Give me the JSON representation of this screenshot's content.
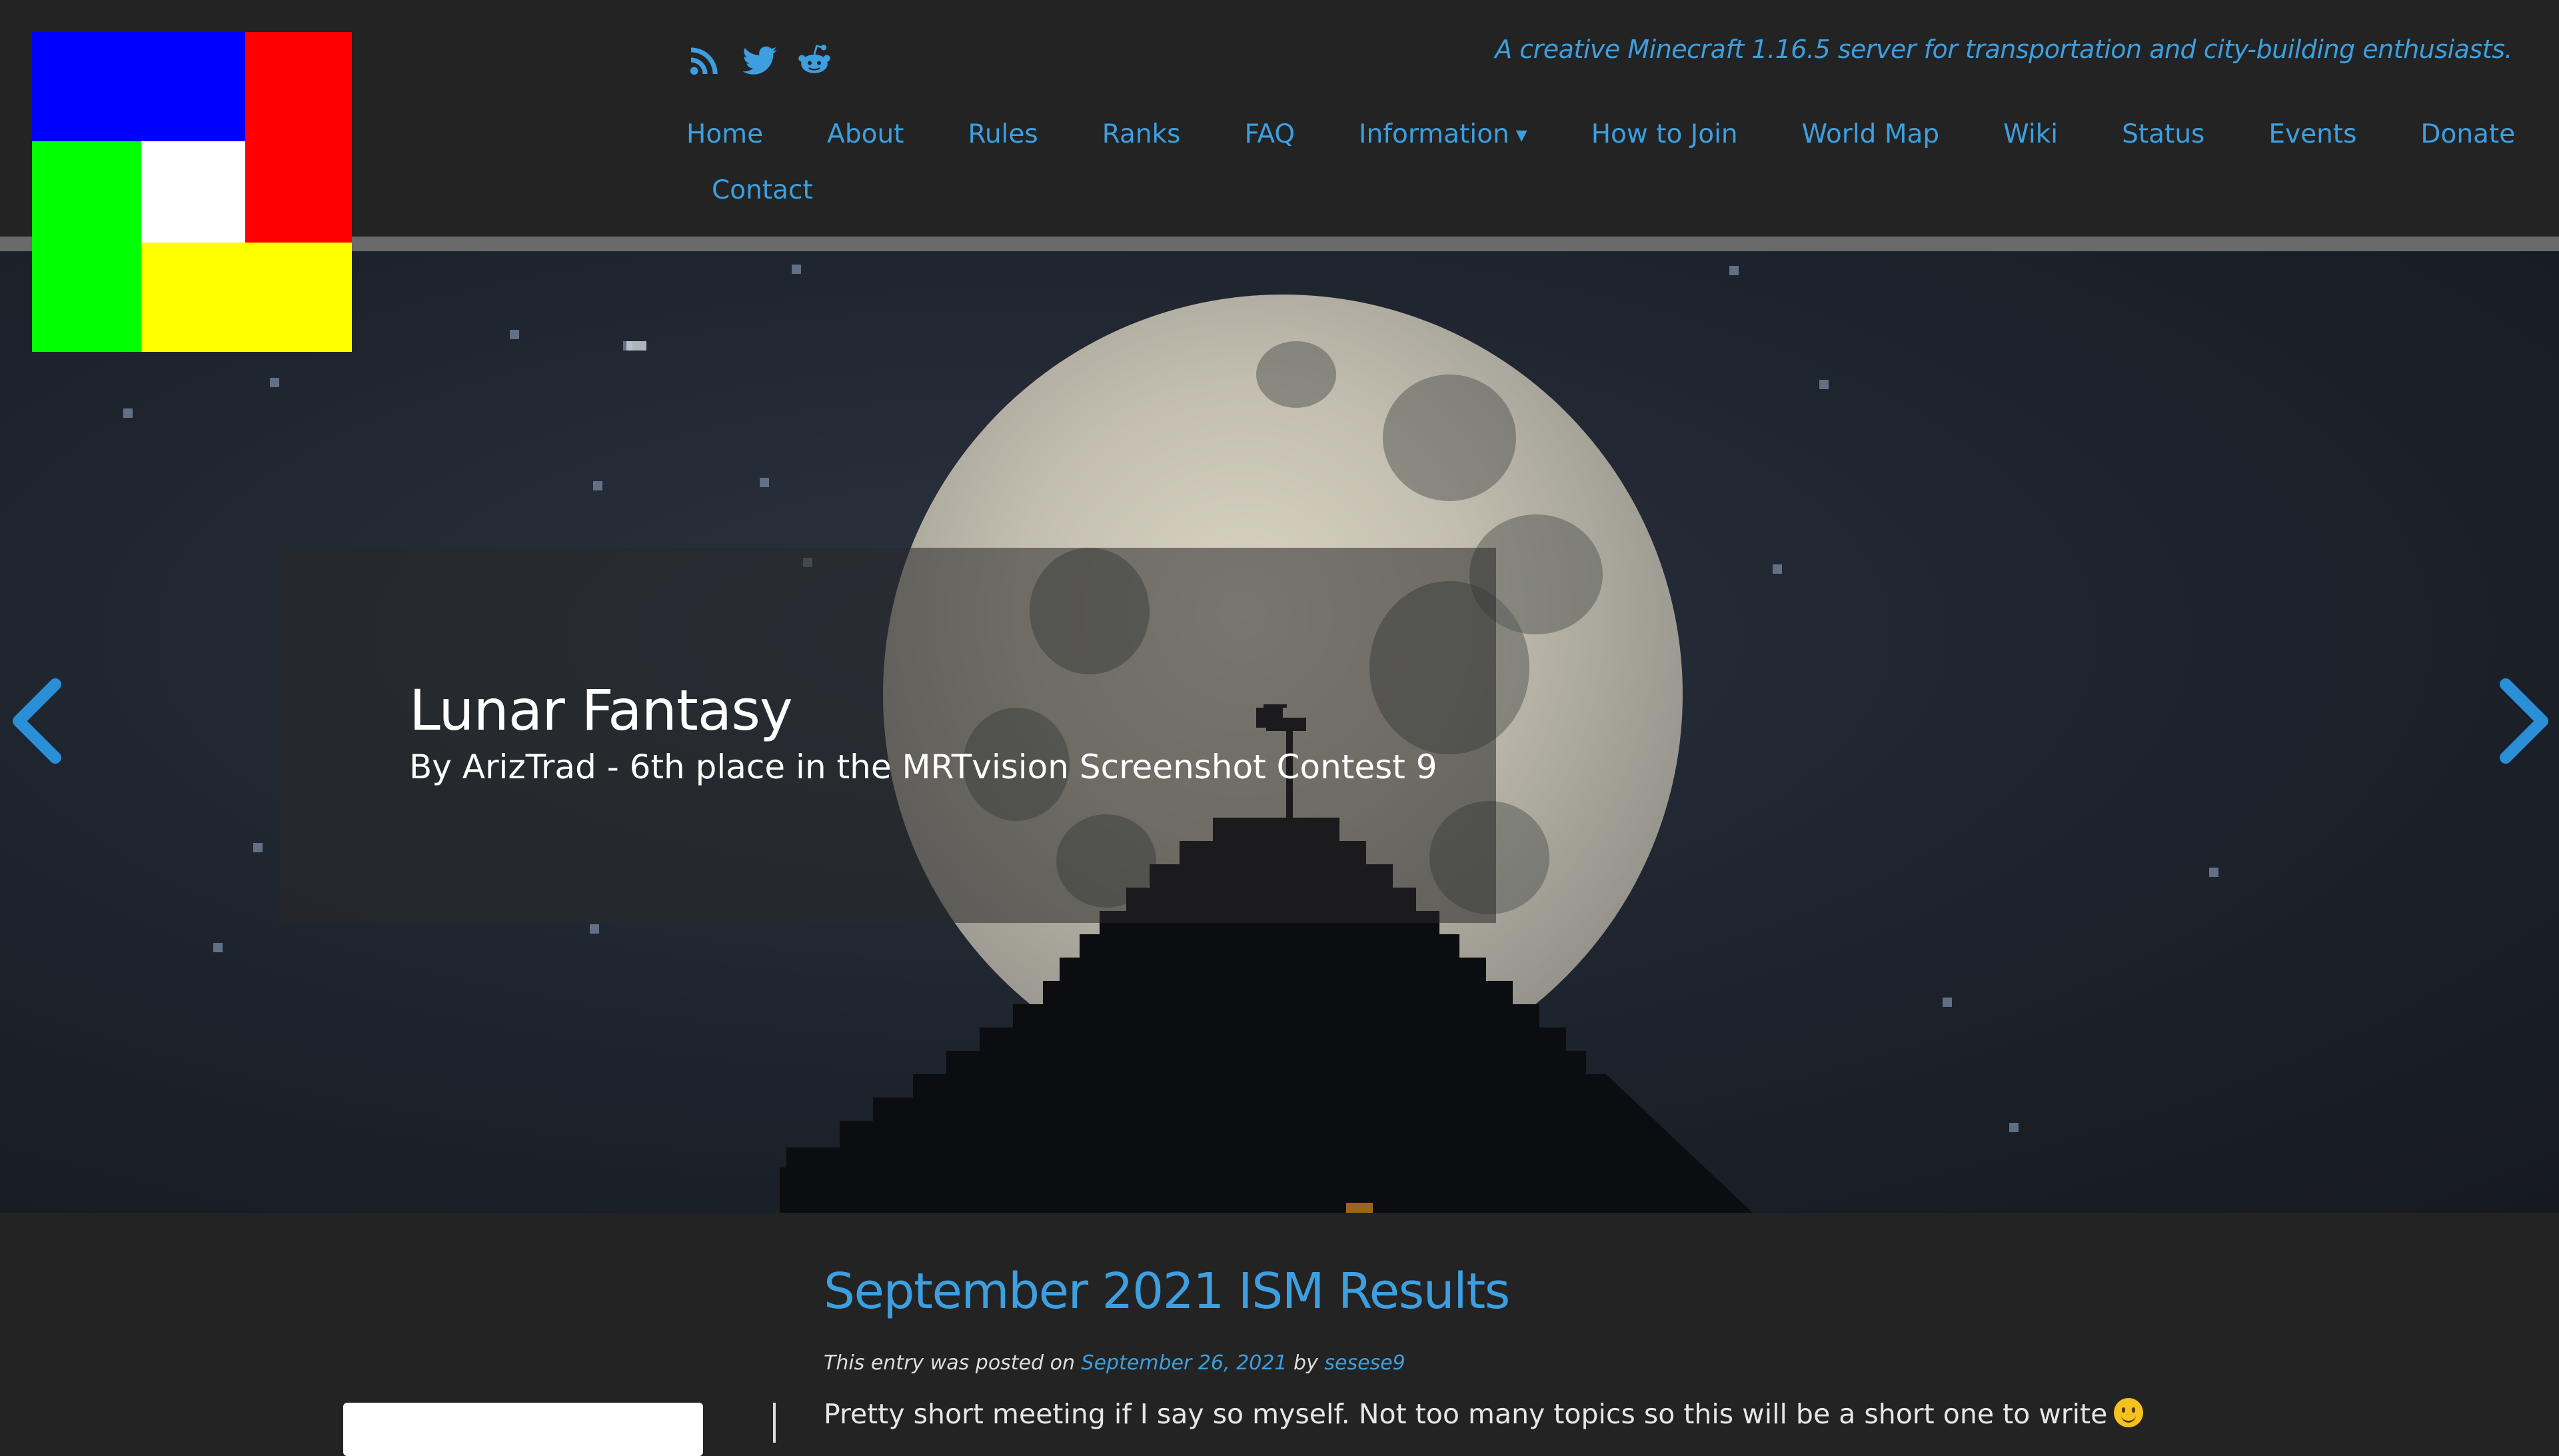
{
  "logo": {
    "name": "server-logo",
    "colors": [
      "#0000ff",
      "#ff0000",
      "#00ff00",
      "#ffffff",
      "#ffff00"
    ]
  },
  "social": [
    {
      "name": "rss-icon"
    },
    {
      "name": "twitter-icon"
    },
    {
      "name": "reddit-icon"
    }
  ],
  "header": {
    "tagline": "A creative Minecraft 1.16.5 server for transportation and city-building enthusiasts."
  },
  "nav": {
    "items": [
      {
        "label": "Home"
      },
      {
        "label": "About"
      },
      {
        "label": "Rules"
      },
      {
        "label": "Ranks"
      },
      {
        "label": "FAQ"
      },
      {
        "label": "Information",
        "dropdown": true
      },
      {
        "label": "How to Join"
      },
      {
        "label": "World Map"
      },
      {
        "label": "Wiki"
      },
      {
        "label": "Status"
      },
      {
        "label": "Events"
      },
      {
        "label": "Donate"
      },
      {
        "label": "Contact"
      }
    ]
  },
  "slider": {
    "title": "Lunar Fantasy",
    "subtitle": "By ArizTrad - 6th place in the MRTvision Screenshot Contest 9",
    "prev_icon": "chevron-left-icon",
    "next_icon": "chevron-right-icon"
  },
  "post": {
    "title": "September 2021 ISM Results",
    "meta_prefix": "This entry was posted on",
    "date": "September 26, 2021",
    "meta_by": "by",
    "author": "sesese9",
    "body": "Pretty short meeting if I say so myself. Not too many topics so this will be a short one to write"
  },
  "colors": {
    "accent": "#3d9fdf",
    "background": "#232323",
    "rule": "#6a6a6a"
  }
}
